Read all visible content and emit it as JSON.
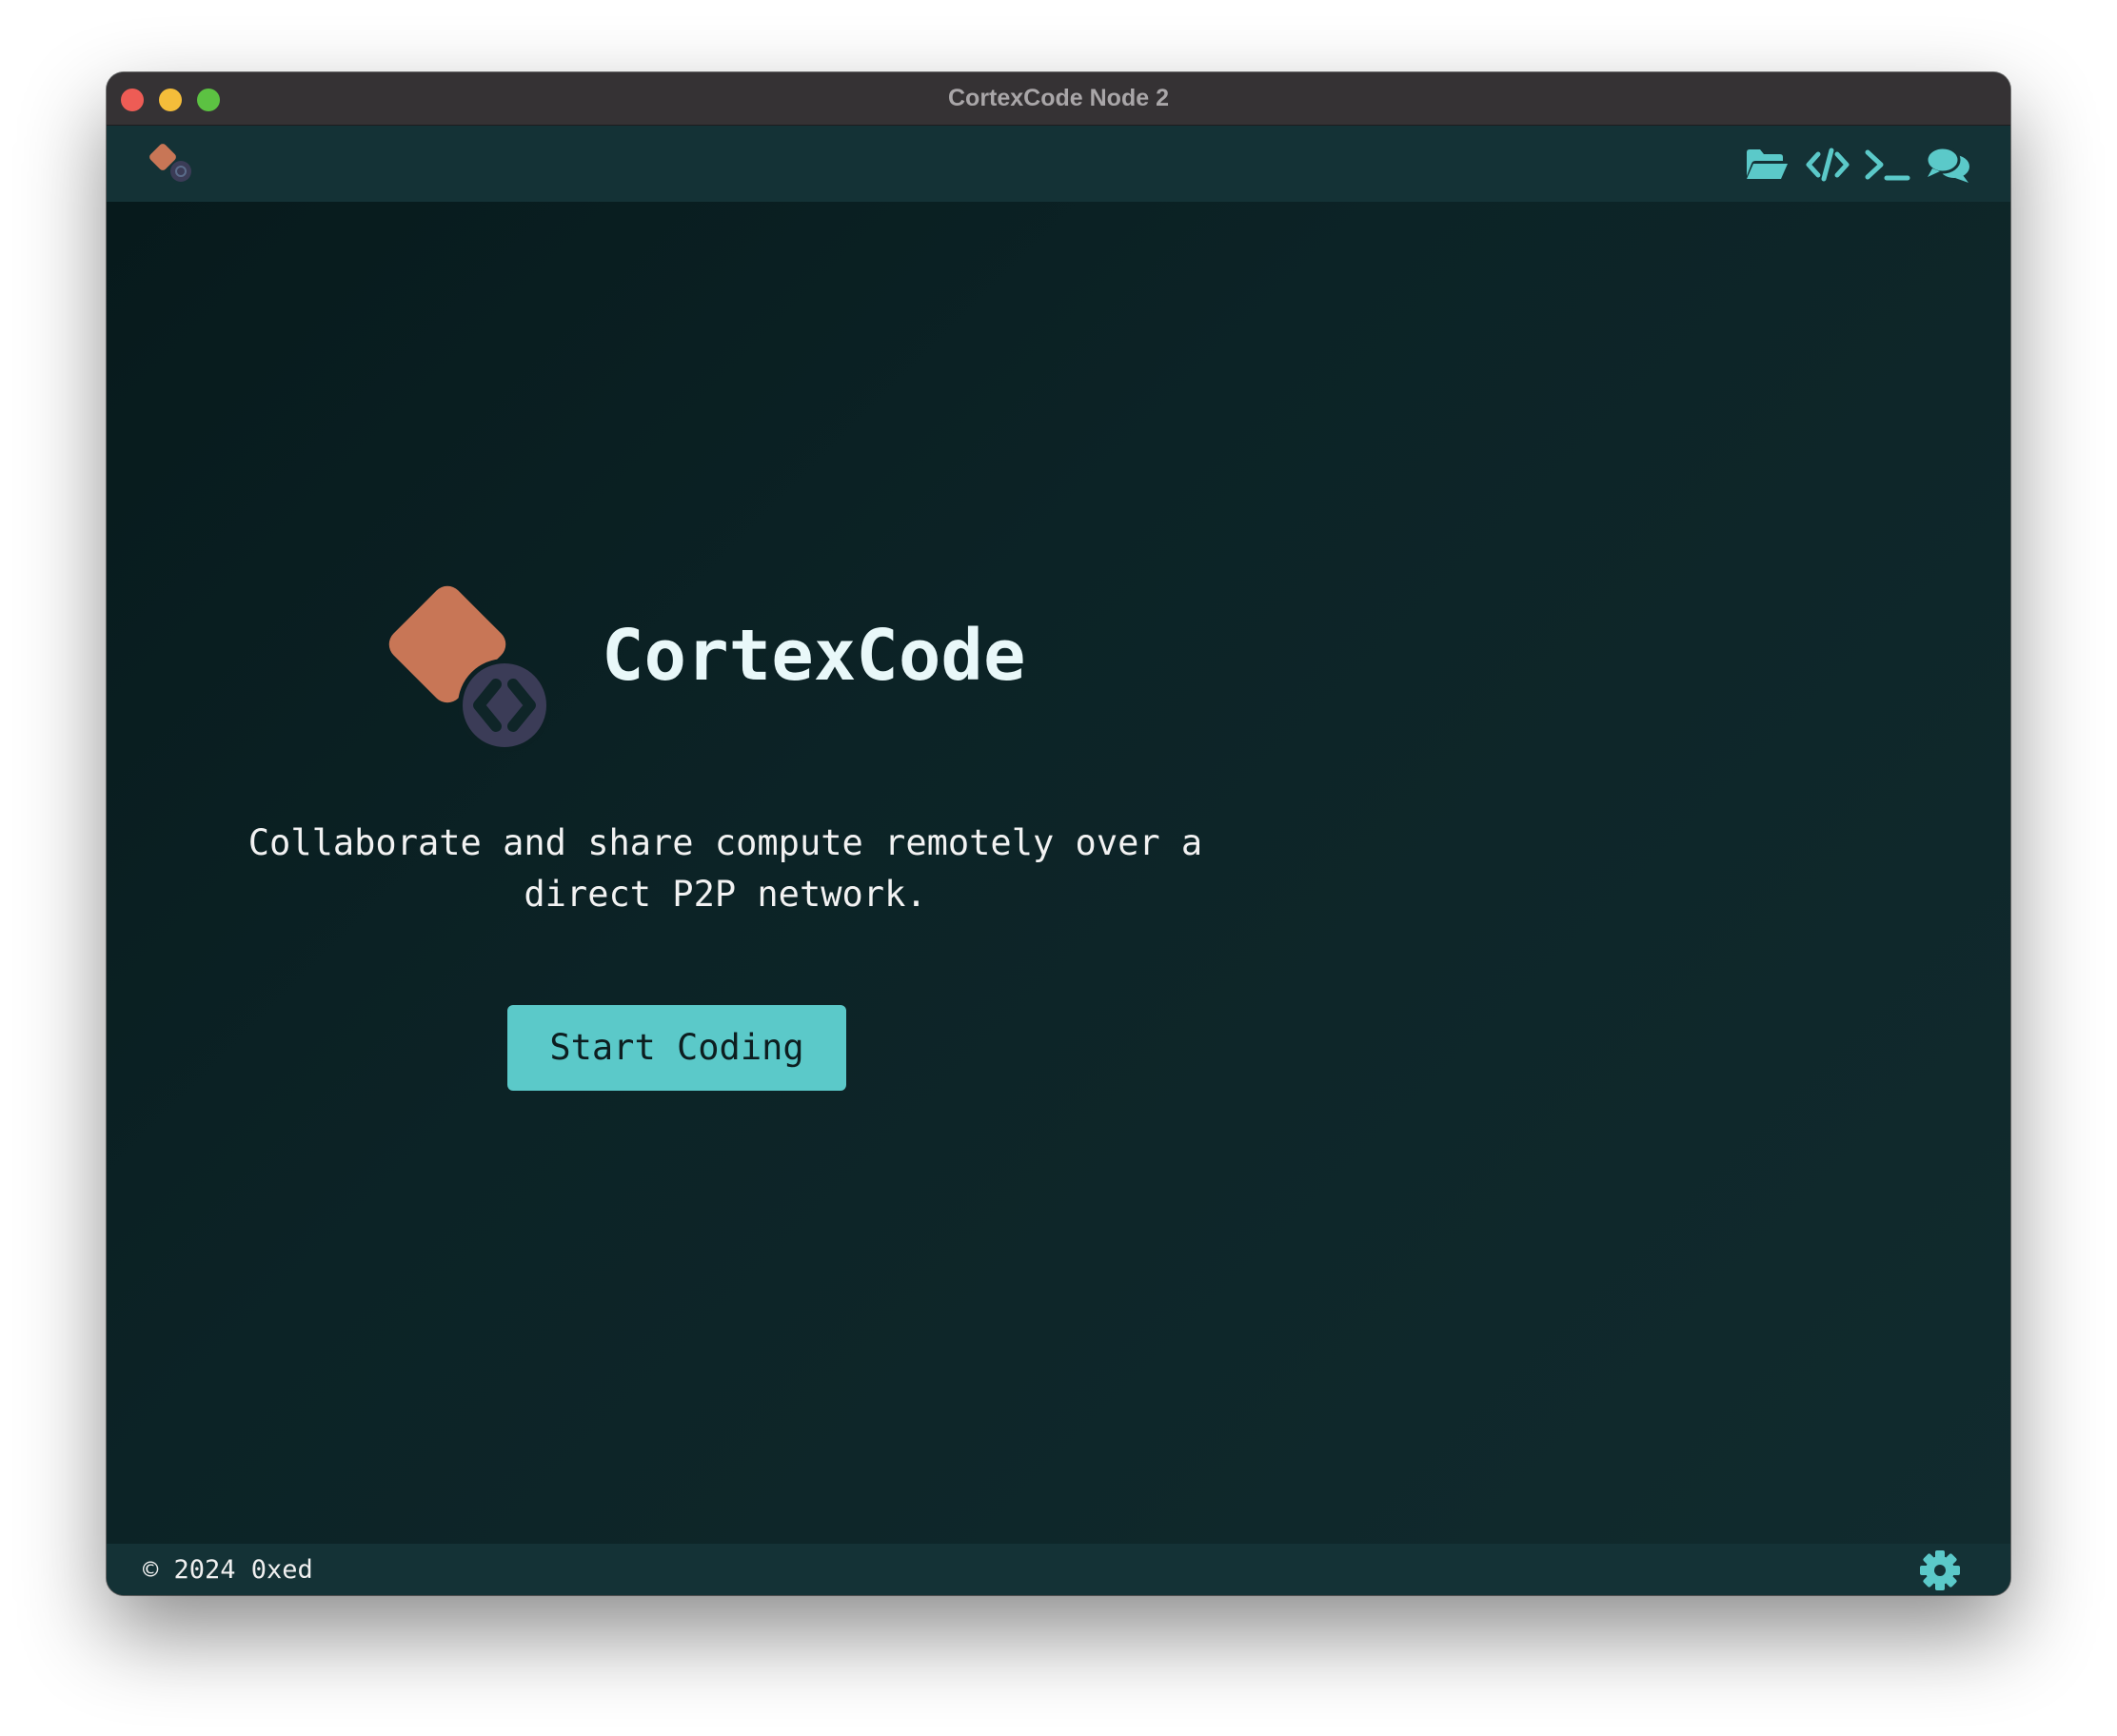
{
  "window": {
    "title": "CortexCode Node 2"
  },
  "topbar": {
    "logo_icon": "cortexcode-logo-icon",
    "nav_icons": [
      "folder-open-icon",
      "code-icon",
      "terminal-icon",
      "chat-icon"
    ]
  },
  "hero": {
    "app_name": "CortexCode",
    "tagline": "Collaborate and share compute remotely over a direct P2P network.",
    "start_button": "Start Coding"
  },
  "footer": {
    "copyright": "© 2024 0xed",
    "settings_icon": "gear-icon"
  },
  "colors": {
    "accent": "#5bc9c9",
    "logo_orange": "#c87656",
    "logo_navy": "#3b3c57",
    "background": "#0f2528",
    "bar": "#143236"
  }
}
